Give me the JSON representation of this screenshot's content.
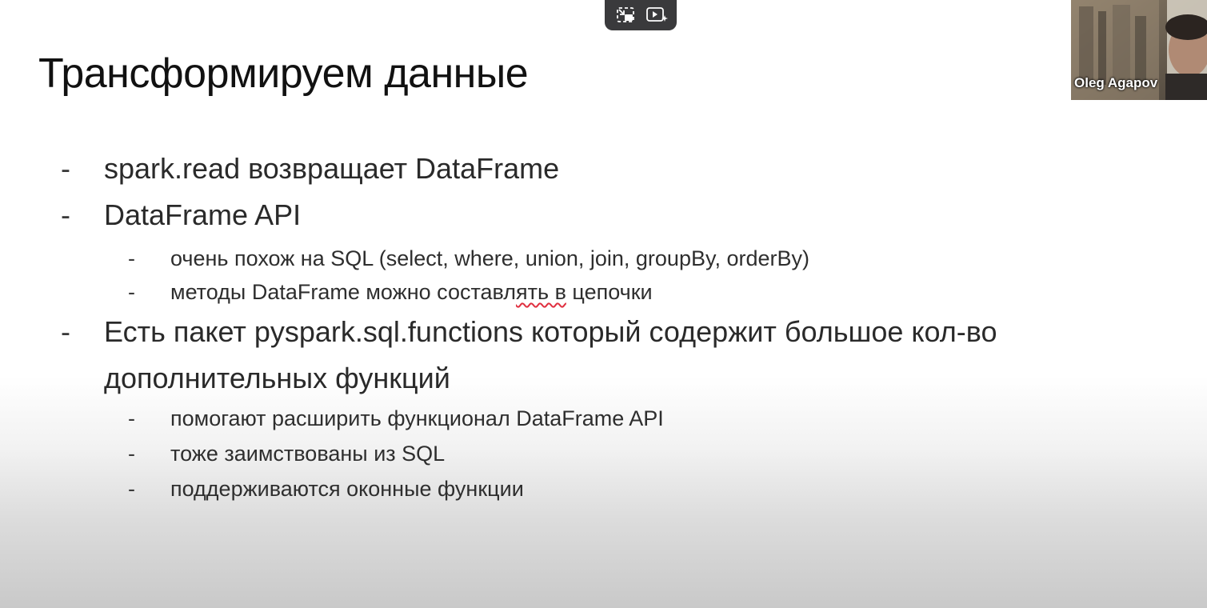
{
  "slide": {
    "title": "Трансформируем данные",
    "bullets": [
      {
        "text": "spark.read возвращает DataFrame"
      },
      {
        "text": "DataFrame API",
        "sub": [
          "очень похож на SQL (select, where, union, join, groupBy, orderBy)",
          "методы DataFrame можно составлять в цепочки"
        ]
      },
      {
        "line1": "Есть пакет pyspark.sql.functions который содержит большое кол-во",
        "line2": "дополнительных функций",
        "sub": [
          "помогают расширить функционал DataFrame API",
          "тоже заимствованы из SQL",
          "поддерживаются оконные функции"
        ]
      }
    ],
    "spell_fragment": {
      "before": "методы DataFrame можно составл",
      "marked": "ять в",
      "after": " цепочки"
    },
    "dash": "-"
  },
  "sub_item_3_2": "тоже заимствованы из SQL",
  "participant": {
    "name": "Oleg Agapov"
  },
  "controls": {
    "icons": [
      "exit-fullscreen-icon",
      "video-effects-icon"
    ]
  },
  "colors": {
    "control_bg": "#3a3a3c",
    "spell_underline": "#e03040"
  }
}
